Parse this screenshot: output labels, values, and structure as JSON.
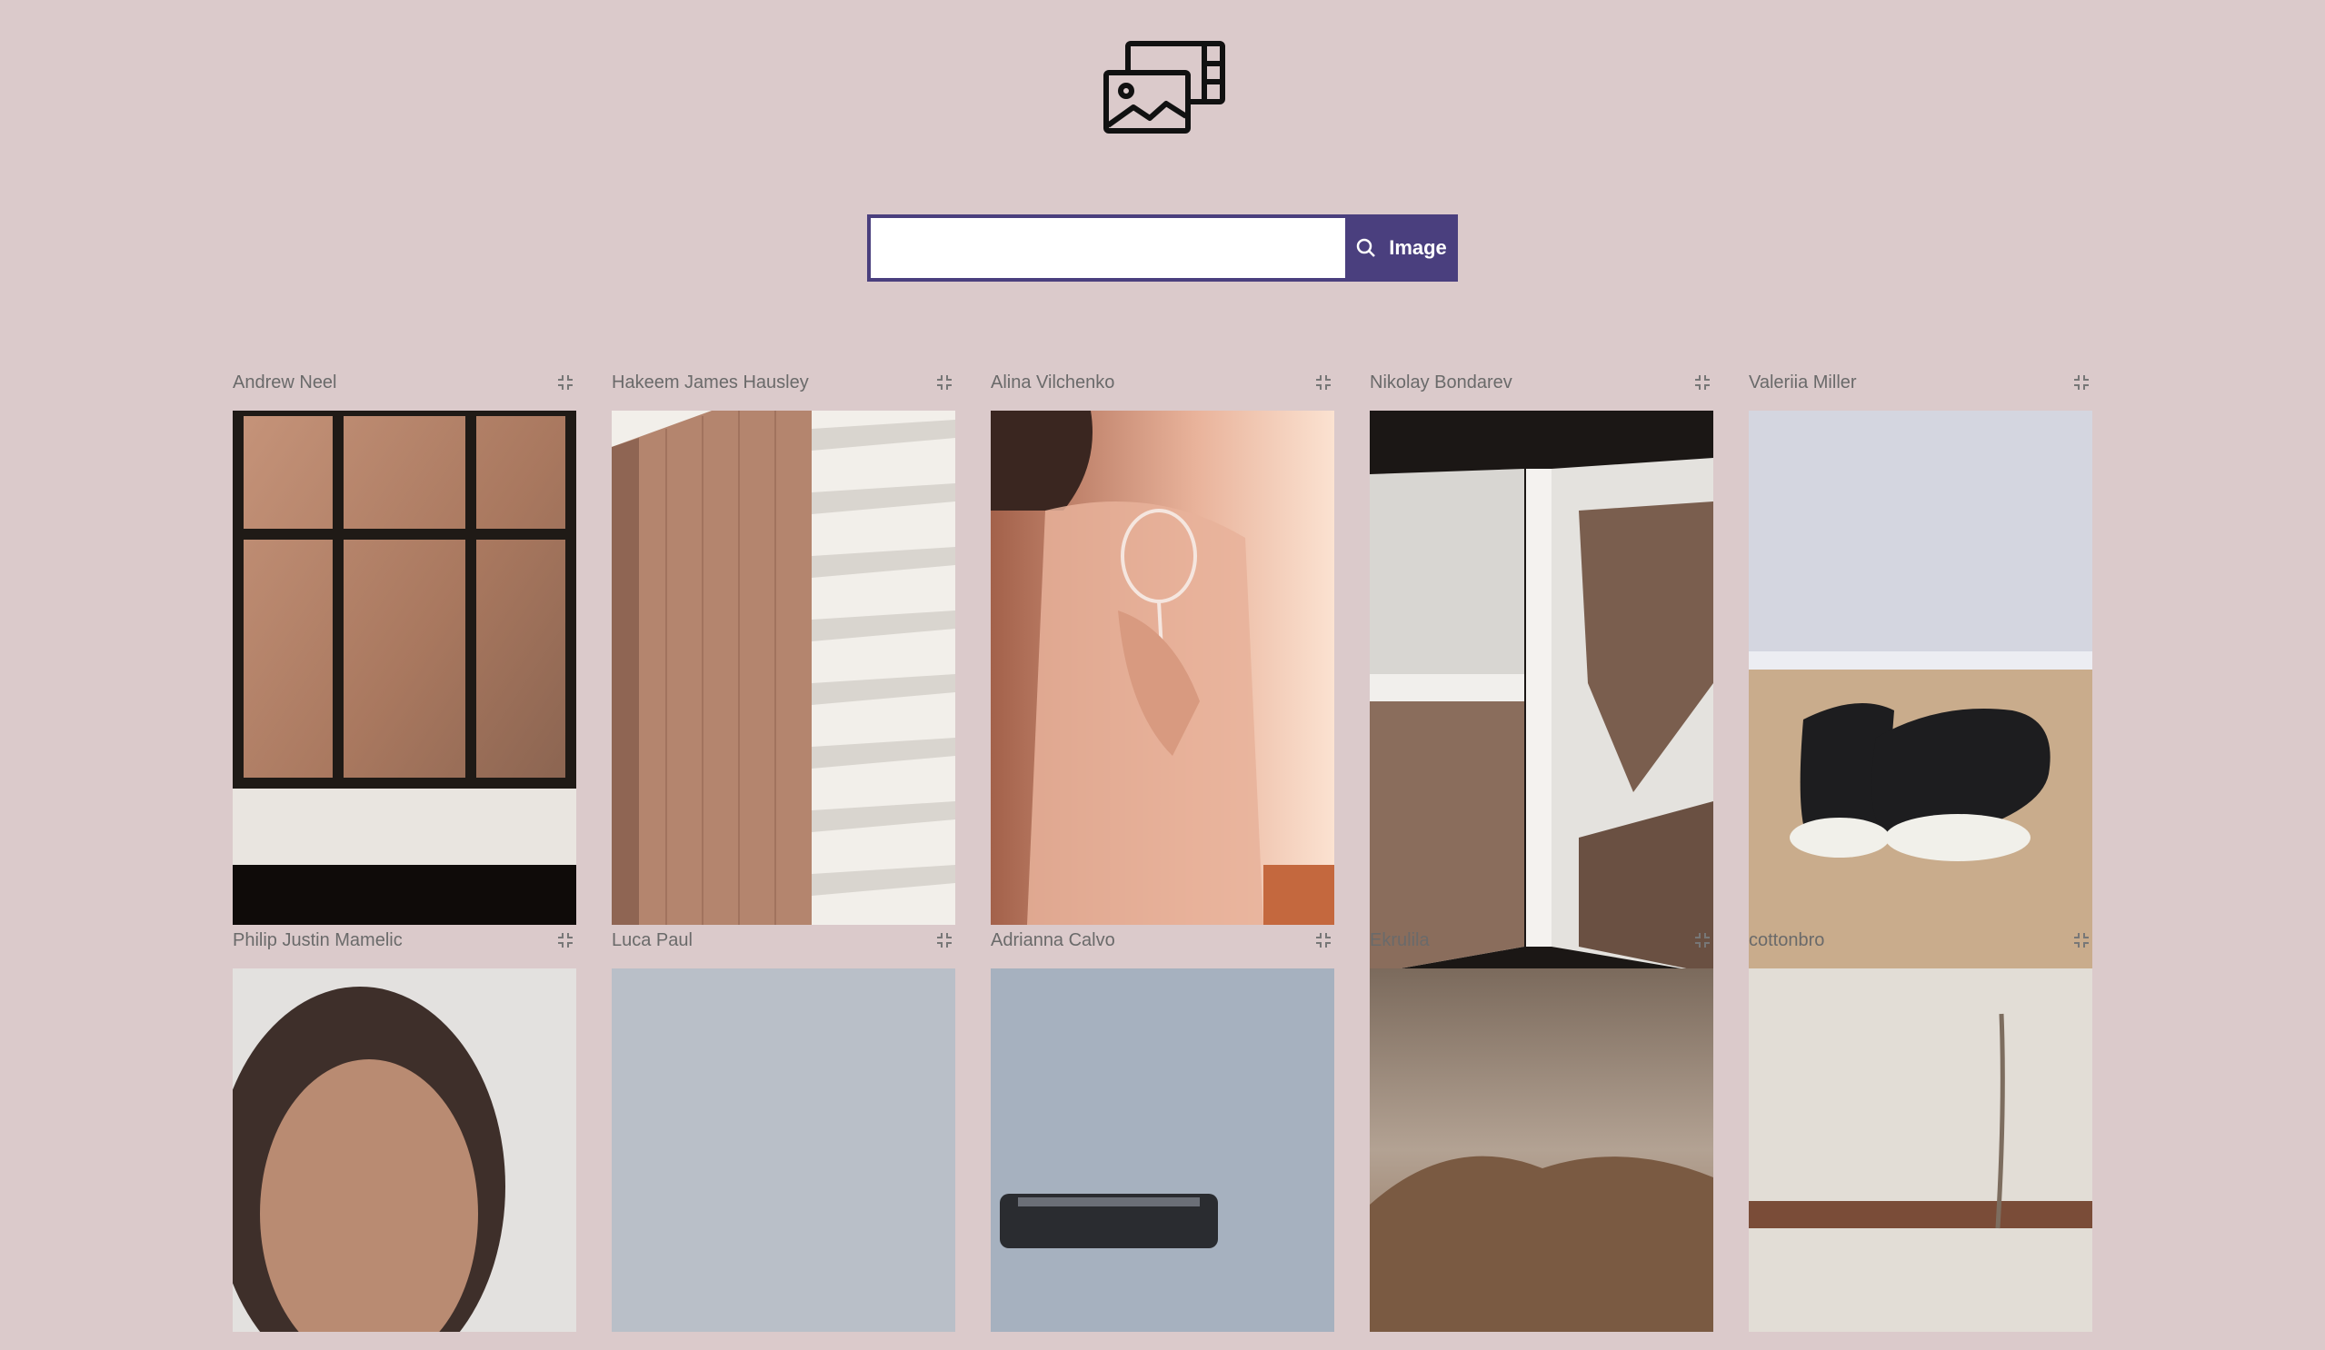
{
  "search": {
    "placeholder": "",
    "value": "",
    "button_label": "Image"
  },
  "colors": {
    "background": "#dbcacb",
    "accent": "#4a3f7e"
  },
  "photos": [
    {
      "author": "Andrew Neel",
      "subject": "rainy window"
    },
    {
      "author": "Hakeem James Hausley",
      "subject": "building facade"
    },
    {
      "author": "Alina Vilchenko",
      "subject": "woman with wine glass"
    },
    {
      "author": "Nikolay Bondarev",
      "subject": "open book"
    },
    {
      "author": "Valeriia Miller",
      "subject": "sneakers"
    },
    {
      "author": "Philip Justin Mamelic",
      "subject": "portrait"
    },
    {
      "author": "Luca Paul",
      "subject": "grey sky"
    },
    {
      "author": "Adrianna Calvo",
      "subject": "camera"
    },
    {
      "author": "Ekrulila",
      "subject": "misty hills"
    },
    {
      "author": "cottonbro",
      "subject": "stick"
    }
  ]
}
